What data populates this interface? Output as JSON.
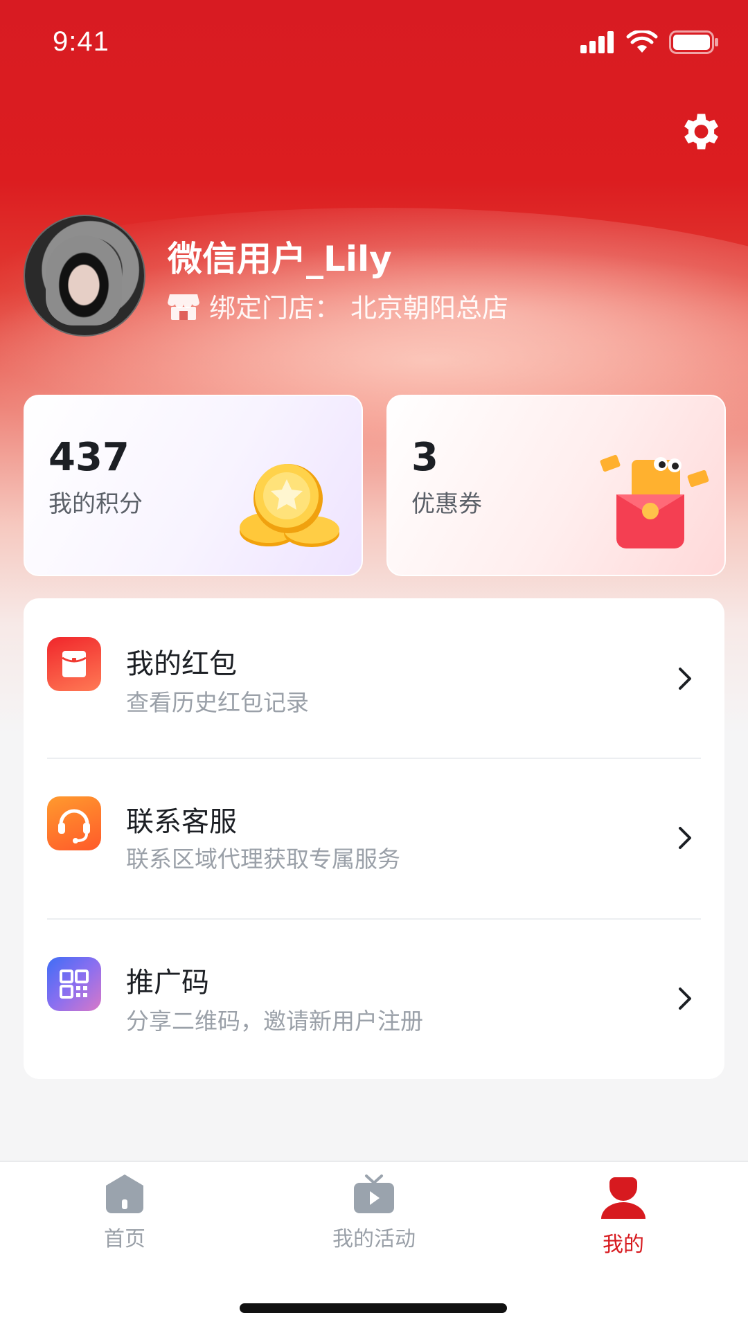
{
  "status": {
    "time": "9:41"
  },
  "profile": {
    "username": "微信用户_Lily",
    "store_label": "绑定门店：",
    "store_name": "北京朝阳总店"
  },
  "stats": {
    "points": {
      "value": "437",
      "label": "我的积分"
    },
    "coupons": {
      "value": "3",
      "label": "优惠券"
    }
  },
  "menu": [
    {
      "title": "我的红包",
      "subtitle": "查看历史红包记录",
      "icon": "red-envelope-icon"
    },
    {
      "title": "联系客服",
      "subtitle": "联系区域代理获取专属服务",
      "icon": "headset-icon"
    },
    {
      "title": "推广码",
      "subtitle": "分享二维码，邀请新用户注册",
      "icon": "qr-code-icon"
    }
  ],
  "tabs": [
    {
      "label": "首页",
      "icon": "home-icon"
    },
    {
      "label": "我的活动",
      "icon": "tv-play-icon"
    },
    {
      "label": "我的",
      "icon": "user-icon",
      "active": true
    }
  ],
  "colors": {
    "brand_red": "#d71a1f",
    "text_primary": "#1c1f24",
    "text_secondary": "#9aa0a8",
    "tab_inactive": "#9aa0a8"
  }
}
